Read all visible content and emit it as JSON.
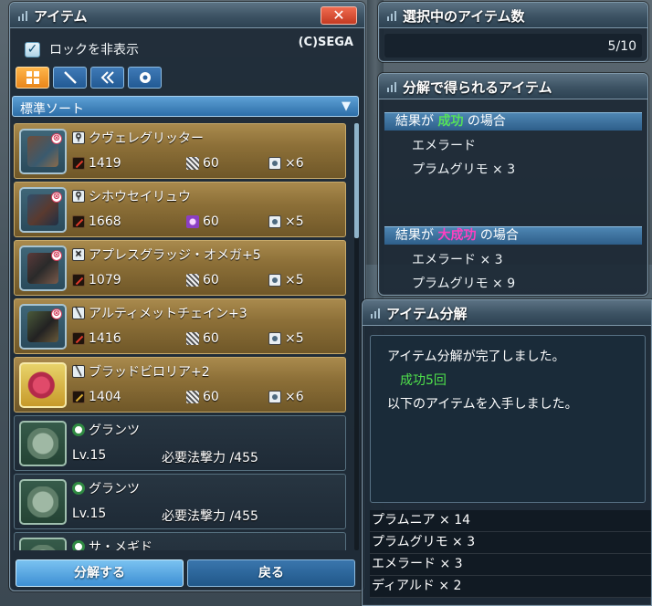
{
  "item_window": {
    "title": "アイテム",
    "close_label": "✕",
    "lock_hide_label": "ロックを非表示",
    "lock_hide_checked": true,
    "copyright": "(C)SEGA",
    "tabs": [
      {
        "icon": "grid-icon",
        "active": true
      },
      {
        "icon": "sword-icon",
        "active": false
      },
      {
        "icon": "double-chevron-icon",
        "active": false
      },
      {
        "icon": "ring-icon",
        "active": false
      }
    ],
    "sort_label": "標準ソート",
    "items": [
      {
        "name": "クヴェレグリッター",
        "type": "weapon",
        "attack": "1419",
        "grind": "60",
        "element": "×6"
      },
      {
        "name": "シホウセイリュウ",
        "type": "weapon",
        "attack": "1668",
        "grind": "60",
        "element": "×5"
      },
      {
        "name": "アプレスグラッジ・オメガ+5",
        "type": "weapon",
        "attack": "1079",
        "grind": "60",
        "element": "×5"
      },
      {
        "name": "アルティメットチェイン+3",
        "type": "weapon",
        "attack": "1416",
        "grind": "60",
        "element": "×5"
      },
      {
        "name": "ブラッドビロリア+2",
        "type": "weapon",
        "attack": "1404",
        "grind": "60",
        "element": "×6"
      },
      {
        "name": "グランツ",
        "type": "unit",
        "level": "Lv.15",
        "requirement": "必要法撃力 /455"
      },
      {
        "name": "グランツ",
        "type": "unit",
        "level": "Lv.15",
        "requirement": "必要法撃力 /455"
      },
      {
        "name": "サ・メギド",
        "type": "unit"
      }
    ],
    "dismantle_button": "分解する",
    "back_button": "戻る"
  },
  "count_window": {
    "title": "選択中のアイテム数",
    "value": "5/10"
  },
  "result_window": {
    "title": "分解で得られるアイテム",
    "success": {
      "prefix": "結果が ",
      "word": "成功",
      "suffix": " の場合",
      "items": [
        "エメラード",
        "プラムグリモ × 3"
      ]
    },
    "great_success": {
      "prefix": "結果が ",
      "word": "大成功",
      "suffix": " の場合",
      "items": [
        "エメラード × 3",
        "プラムグリモ × 9"
      ]
    }
  },
  "dismantle_window": {
    "title": "アイテム分解",
    "message_done": "アイテム分解が完了しました。",
    "success_count": "成功5回",
    "message_obtained": "以下のアイテムを入手しました。",
    "obtained": [
      "プラムニア × 14",
      "プラムグリモ × 3",
      "エメラード × 3",
      "ディアルド × 2"
    ]
  },
  "colors": {
    "success_green": "#55e05a",
    "great_success_magenta": "#ff3fc0",
    "accent_blue": "#3d8fd3",
    "rare_gold": "#8d7038"
  }
}
